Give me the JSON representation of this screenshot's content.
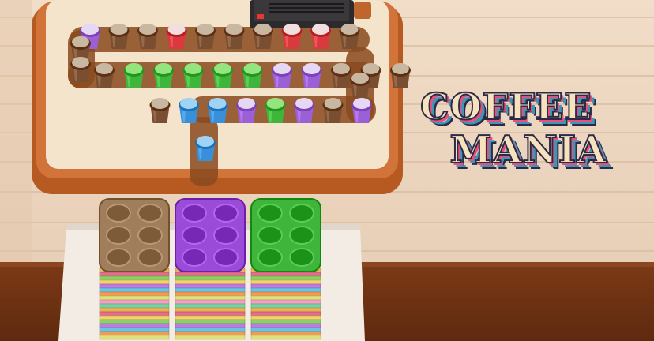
{
  "logo": {
    "line1": "COFFEE",
    "line2": "MANIA"
  },
  "colors": {
    "coffee": "#7a4e30",
    "red": "#d83a3e",
    "green": "#3fb53b",
    "purple": "#9b5fd6",
    "blue": "#3a90d8"
  },
  "conveyor": {
    "row1": [
      "purple",
      "coffee",
      "coffee",
      "red",
      "coffee",
      "coffee",
      "coffee",
      "red",
      "red",
      "coffee"
    ],
    "row2": [
      "coffee",
      "green",
      "green",
      "green",
      "green",
      "green",
      "purple",
      "purple",
      "coffee",
      "coffee",
      "coffee"
    ],
    "row3": [
      "coffee",
      "blue",
      "blue",
      "purple",
      "green",
      "purple",
      "coffee",
      "purple"
    ],
    "row_left": [
      "coffee",
      "coffee"
    ],
    "exit": [
      "blue"
    ]
  },
  "tray_stacks": [
    {
      "top_color": "coffee"
    },
    {
      "top_color": "purple"
    },
    {
      "top_color": "green"
    }
  ]
}
